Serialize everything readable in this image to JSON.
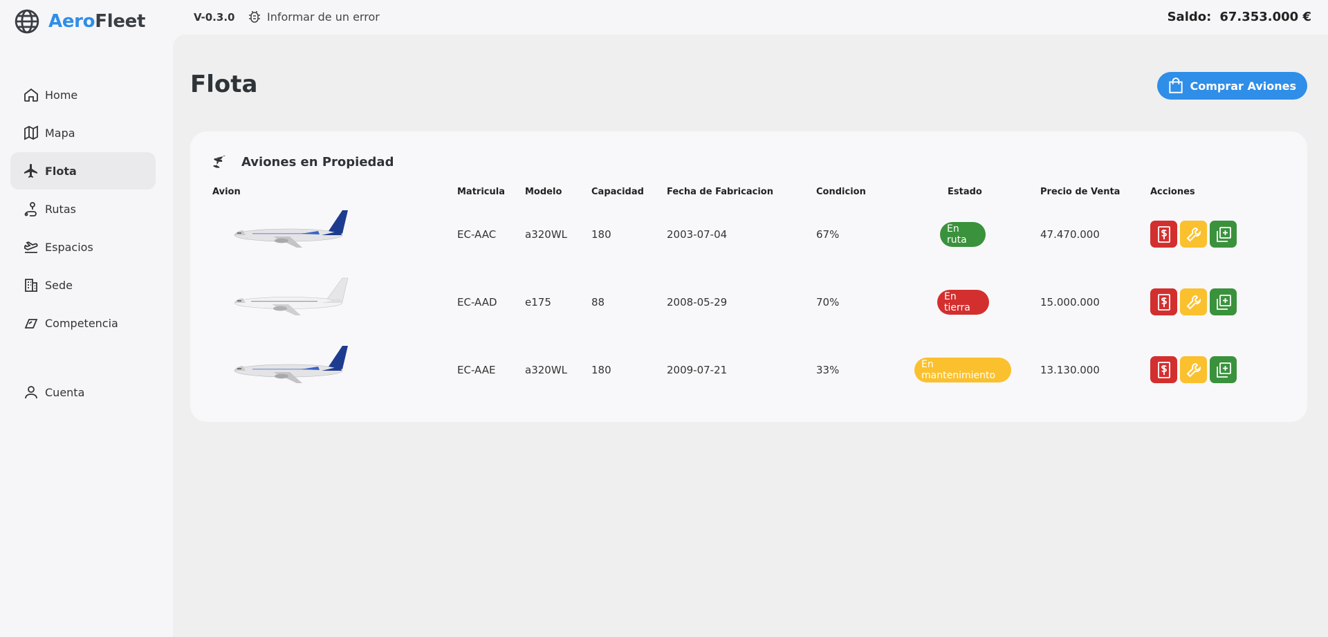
{
  "app": {
    "logo_part1": "Aero",
    "logo_part2": "Fleet",
    "version": "V-0.3.0",
    "report_label": "Informar de un error",
    "balance_label": "Saldo:",
    "balance_value": "67.353.000 €"
  },
  "sidebar": {
    "items": [
      {
        "label": "Home",
        "icon": "home-icon"
      },
      {
        "label": "Mapa",
        "icon": "map-icon"
      },
      {
        "label": "Flota",
        "icon": "plane-icon",
        "active": true
      },
      {
        "label": "Rutas",
        "icon": "route-icon"
      },
      {
        "label": "Espacios",
        "icon": "takeoff-icon"
      },
      {
        "label": "Sede",
        "icon": "building-icon"
      },
      {
        "label": "Competencia",
        "icon": "competition-icon"
      },
      {
        "label": "Cuenta",
        "icon": "user-icon"
      }
    ]
  },
  "main": {
    "title": "Flota",
    "buy_button": "Comprar Aviones",
    "card_title": "Aviones en Propiedad",
    "columns": [
      "Avion",
      "Matricula",
      "Modelo",
      "Capacidad",
      "Fecha de Fabricacion",
      "Condicion",
      "Estado",
      "Precio de Venta",
      "Acciones"
    ],
    "rows": [
      {
        "matricula": "EC-AAC",
        "modelo": "a320WL",
        "capacidad": "180",
        "fecha": "2003-07-04",
        "condicion": "67%",
        "estado": "En ruta",
        "estado_color": "#3a923c",
        "precio": "47.470.000",
        "livery": "airbus"
      },
      {
        "matricula": "EC-AAD",
        "modelo": "e175",
        "capacidad": "88",
        "fecha": "2008-05-29",
        "condicion": "70%",
        "estado": "En tierra",
        "estado_color": "#d32f2f",
        "precio": "15.000.000",
        "livery": "white"
      },
      {
        "matricula": "EC-AAE",
        "modelo": "a320WL",
        "capacidad": "180",
        "fecha": "2009-07-21",
        "condicion": "33%",
        "estado": "En mantenimiento",
        "estado_color": "#fbc02d",
        "precio": "13.130.000",
        "livery": "airbus"
      }
    ]
  },
  "colors": {
    "accent": "#2f8ee8",
    "success": "#3a923c",
    "danger": "#d32f2f",
    "warning": "#fbc02d"
  },
  "icons": {
    "actions": [
      "sell-icon",
      "repair-icon",
      "add-icon"
    ]
  }
}
